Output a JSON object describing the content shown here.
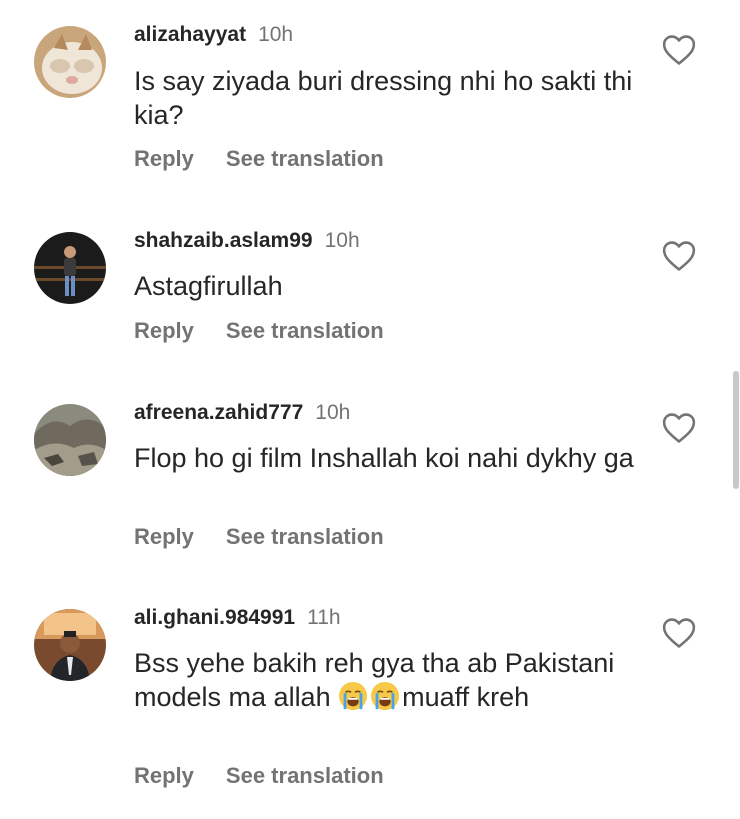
{
  "comments": [
    {
      "username": "alizahayyat",
      "time": "10h",
      "text": "Is say ziyada buri dressing nhi ho sakti thi kia?",
      "reply_label": "Reply",
      "translate_label": "See translation"
    },
    {
      "username": "shahzaib.aslam99",
      "time": "10h",
      "text": "Astagfirullah",
      "reply_label": "Reply",
      "translate_label": "See translation"
    },
    {
      "username": "afreena.zahid777",
      "time": "10h",
      "text": "Flop  ho gi film Inshallah koi nahi dykhy ga",
      "reply_label": "Reply",
      "translate_label": "See translation"
    },
    {
      "username": "ali.ghani.984991",
      "time": "11h",
      "text_before": "Bss yehe bakih reh gya tha ab Pakistani models ma allah ",
      "text_after": "muaff kreh",
      "emojis": [
        "loudly-crying-face",
        "loudly-crying-face"
      ],
      "reply_label": "Reply",
      "translate_label": "See translation"
    }
  ],
  "icons": {
    "like": "heart-outline-icon"
  },
  "colors": {
    "text": "#262626",
    "secondary": "#737373"
  }
}
